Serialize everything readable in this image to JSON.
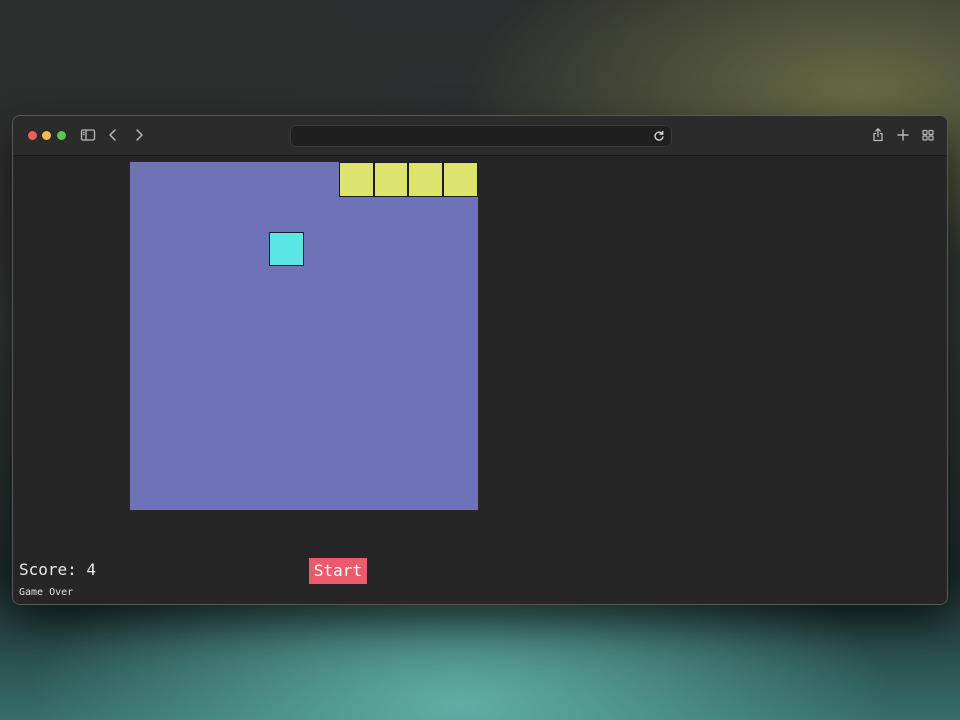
{
  "browser": {
    "traffic_lights": [
      "#ee5f57",
      "#f5bd4f",
      "#5ec44f"
    ],
    "address_value": "",
    "icons": {
      "sidebar": "sidebar-toggle-icon",
      "back": "chevron-left-icon",
      "forward": "chevron-right-icon",
      "reload": "reload-icon",
      "share": "share-icon",
      "new_tab": "plus-icon",
      "tab_overview": "tab-grid-icon"
    }
  },
  "game": {
    "board_color": "#6e72b7",
    "grid_size": 10,
    "snake_color": "#dde46c",
    "food_color": "#5be6e6",
    "snake": [
      [
        6,
        0
      ],
      [
        7,
        0
      ],
      [
        8,
        0
      ],
      [
        9,
        0
      ]
    ],
    "food": [
      4,
      2
    ],
    "score_text": "Score: 4",
    "status_text": "Game Over",
    "start_label": "Start",
    "start_color": "#eb5b6c"
  }
}
